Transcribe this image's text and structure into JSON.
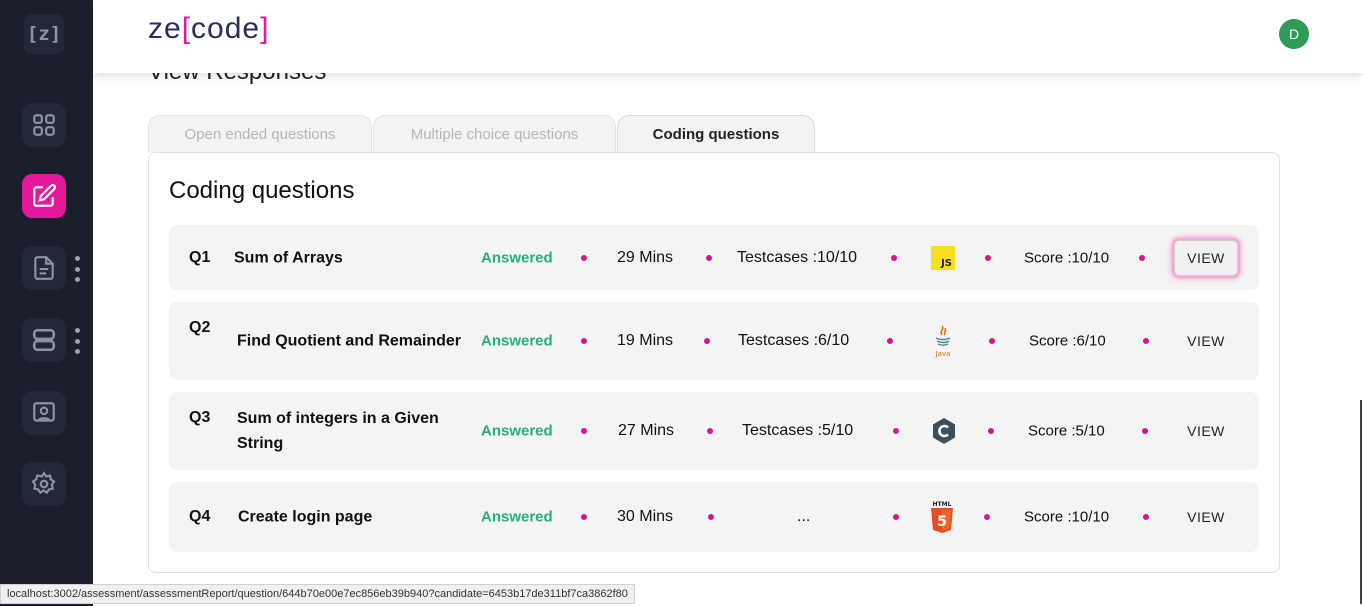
{
  "sidebar": {
    "logo": "[z]",
    "items": [
      {
        "icon": "grid-icon"
      },
      {
        "icon": "edit-icon",
        "active": true
      },
      {
        "icon": "document-icon",
        "has_menu": true
      },
      {
        "icon": "server-icon",
        "has_menu": true
      },
      {
        "icon": "monitor-icon"
      },
      {
        "icon": "gear-icon"
      }
    ]
  },
  "header": {
    "brand_prefix": "ze",
    "brand_open": "[",
    "brand_word": "code",
    "brand_close": "]",
    "avatar_initial": "D",
    "avatar_color": "#2e9b57"
  },
  "page": {
    "heading": "View Responses",
    "tabs": [
      "Open ended questions",
      "Multiple choice questions",
      "Coding questions"
    ],
    "active_tab": "Coding questions",
    "panel_title": "Coding questions"
  },
  "questions": [
    {
      "num": "Q1",
      "title": "Sum of Arrays",
      "status": "Answered",
      "duration": "29 Mins",
      "testcases": "Testcases :10/10",
      "language_icon": "javascript-icon",
      "score": "Score :10/10",
      "action": "VIEW"
    },
    {
      "num": "Q2",
      "title": "Find Quotient and Remainder",
      "status": "Answered",
      "duration": "19 Mins",
      "testcases": "Testcases :6/10",
      "language_icon": "java-icon",
      "score": "Score :6/10",
      "action": "VIEW"
    },
    {
      "num": "Q3",
      "title": "Sum of integers in a Given String",
      "status": "Answered",
      "duration": "27 Mins",
      "testcases": "Testcases :5/10",
      "language_icon": "c-lang-icon",
      "score": "Score :5/10",
      "action": "VIEW"
    },
    {
      "num": "Q4",
      "title": "Create login page",
      "status": "Answered",
      "duration": "30 Mins",
      "testcases": "...",
      "language_icon": "html5-icon",
      "score": "Score :10/10",
      "action": "VIEW"
    }
  ],
  "colors": {
    "accent": "#e5189b",
    "answered": "#27ae7a",
    "sidebar_bg": "#1b1f2c",
    "js_yellow": "#f7df1e",
    "html_orange": "#e44d26"
  },
  "status_url": "localhost:3002/assessment/assessmentReport/question/644b70e00e7ec856eb39b940?candidate=6453b17de311bf7ca3862f80"
}
